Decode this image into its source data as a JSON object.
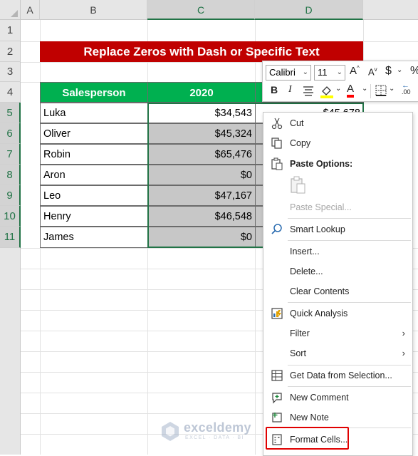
{
  "columns": [
    "A",
    "B",
    "C",
    "D"
  ],
  "rows": [
    "1",
    "2",
    "3",
    "4",
    "5",
    "6",
    "7",
    "8",
    "9",
    "10",
    "11"
  ],
  "title": "Replace Zeros with Dash or Specific Text",
  "table": {
    "headers": [
      "Salesperson",
      "2020"
    ],
    "rows": [
      {
        "name": "Luka",
        "v2020": "$34,543",
        "v2021": "$45,678"
      },
      {
        "name": "Oliver",
        "v2020": "$45,324"
      },
      {
        "name": "Robin",
        "v2020": "$65,476"
      },
      {
        "name": "Aron",
        "v2020": "$0"
      },
      {
        "name": "Leo",
        "v2020": "$47,167"
      },
      {
        "name": "Henry",
        "v2020": "$46,548"
      },
      {
        "name": "James",
        "v2020": "$0"
      }
    ]
  },
  "mini_toolbar": {
    "font_name": "Calibri",
    "font_size": "11",
    "grow": "A",
    "shrink": "A",
    "currency": "$",
    "percent": "%",
    "bold": "B",
    "italic": "I",
    "font_color_letter": "A",
    "decimal_label": ".00"
  },
  "context_menu": {
    "items": [
      {
        "label": "Cut",
        "icon": "scissors-icon",
        "enabled": true
      },
      {
        "label": "Copy",
        "icon": "copy-icon",
        "enabled": true
      },
      {
        "label": "Paste Options:",
        "icon": "paste-icon",
        "enabled": true,
        "bold": true
      },
      {
        "label": "Paste Special...",
        "enabled": false
      },
      {
        "label": "Smart Lookup",
        "icon": "search-icon",
        "enabled": true
      },
      {
        "label": "Insert...",
        "enabled": true
      },
      {
        "label": "Delete...",
        "enabled": true
      },
      {
        "label": "Clear Contents",
        "enabled": true
      },
      {
        "label": "Quick Analysis",
        "icon": "quick-analysis-icon",
        "enabled": true
      },
      {
        "label": "Filter",
        "enabled": true,
        "submenu": true
      },
      {
        "label": "Sort",
        "enabled": true,
        "submenu": true
      },
      {
        "label": "Get Data from Selection...",
        "icon": "table-icon",
        "enabled": true
      },
      {
        "label": "New Comment",
        "icon": "comment-icon",
        "enabled": true
      },
      {
        "label": "New Note",
        "icon": "note-icon",
        "enabled": true
      },
      {
        "label": "Format Cells...",
        "icon": "format-cells-icon",
        "enabled": true,
        "highlighted": true
      }
    ]
  },
  "watermark": {
    "name": "exceldemy",
    "tagline": "EXCEL · DATA · BI"
  },
  "colors": {
    "banner": "#c00000",
    "header_green": "#00b050",
    "excel_green": "#217346",
    "highlight_red": "#e00000",
    "selection_gray": "#c7c7c7"
  }
}
